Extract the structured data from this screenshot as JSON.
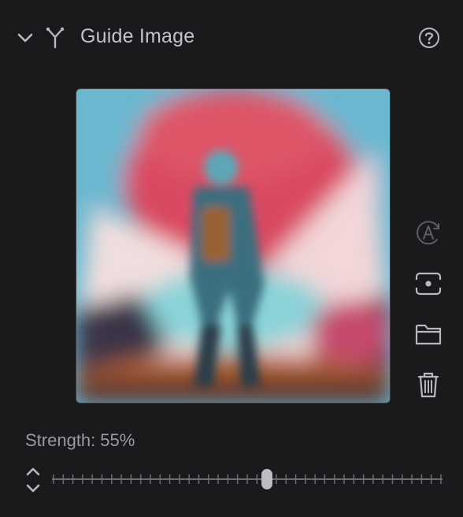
{
  "header": {
    "title": "Guide Image",
    "collapse_icon": "chevron-down-icon",
    "section_icon": "fork-icon",
    "help_icon": "question-circle-icon"
  },
  "guide_image": {
    "description_icon": "guide-image-thumbnail"
  },
  "actions": [
    {
      "icon": "auto-a-icon",
      "enabled": false
    },
    {
      "icon": "capture-frame-icon",
      "enabled": true
    },
    {
      "icon": "folder-icon",
      "enabled": true
    },
    {
      "icon": "trash-icon",
      "enabled": true
    }
  ],
  "strength": {
    "label": "Strength:",
    "value_text": "55%",
    "value": 0.55
  },
  "colors": {
    "background": "#1a1a1c",
    "icon": "#b9b9bd",
    "icon_disabled": "#5e5e63",
    "thumb": "#bdbdc1"
  }
}
